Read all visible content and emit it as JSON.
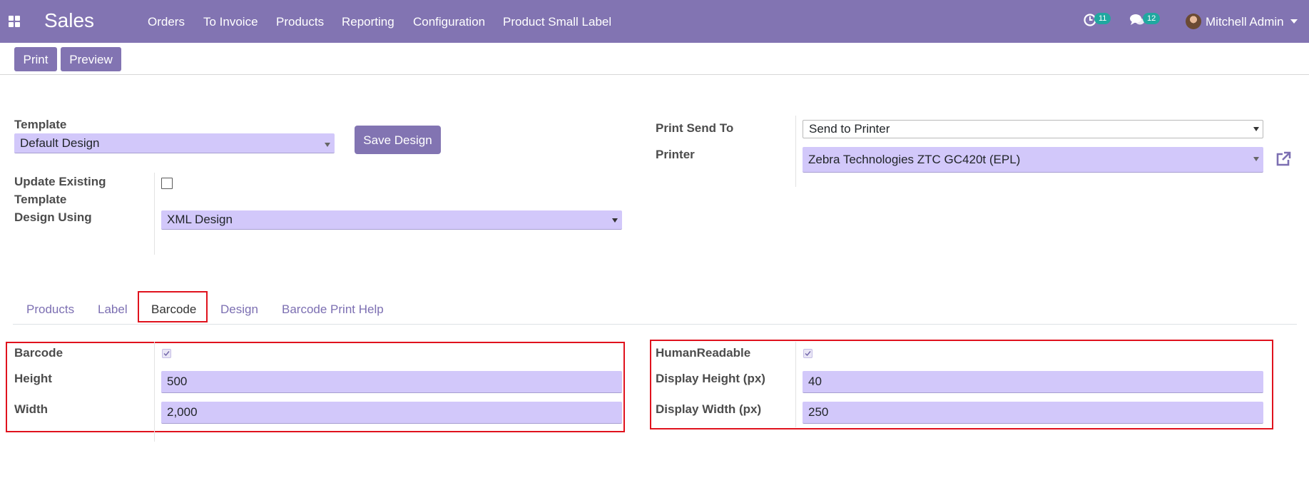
{
  "navbar": {
    "brand": "Sales",
    "menu": [
      "Orders",
      "To Invoice",
      "Products",
      "Reporting",
      "Configuration",
      "Product Small Label"
    ],
    "activity_count": "11",
    "messages_count": "12",
    "user_name": "Mitchell Admin",
    "icons": [
      "apps-grid-icon",
      "activity-clock-icon",
      "chat-bubbles-icon",
      "user-avatar",
      "caret-down-icon"
    ]
  },
  "control_panel": {
    "print_label": "Print",
    "preview_label": "Preview"
  },
  "form": {
    "template_label": "Template",
    "template_value": "Default Design",
    "save_design_label": "Save Design",
    "update_existing_label_line1": "Update Existing",
    "update_existing_label_line2": "Template",
    "update_existing_checked": false,
    "design_using_label": "Design Using",
    "design_using_value": "XML Design",
    "print_send_to_label": "Print Send To",
    "print_send_to_value": "Send to Printer",
    "printer_label": "Printer",
    "printer_value": "Zebra Technologies ZTC GC420t (EPL)"
  },
  "tabs": {
    "items": [
      "Products",
      "Label",
      "Barcode",
      "Design",
      "Barcode Print Help"
    ],
    "active": "Barcode"
  },
  "barcode_tab": {
    "barcode_label": "Barcode",
    "barcode_checked": true,
    "height_label": "Height",
    "height_value": "500",
    "width_label": "Width",
    "width_value": "2,000",
    "human_readable_label": "HumanReadable",
    "human_readable_checked": true,
    "display_height_label": "Display Height (px)",
    "display_height_value": "40",
    "display_width_label": "Display Width (px)",
    "display_width_value": "250"
  },
  "colors": {
    "navbar": "#8274b2",
    "field_fill": "#d2c8fa",
    "highlight_border": "#e0121d",
    "tab_link": "#7c6fb2",
    "badge": "#20a8a0"
  }
}
